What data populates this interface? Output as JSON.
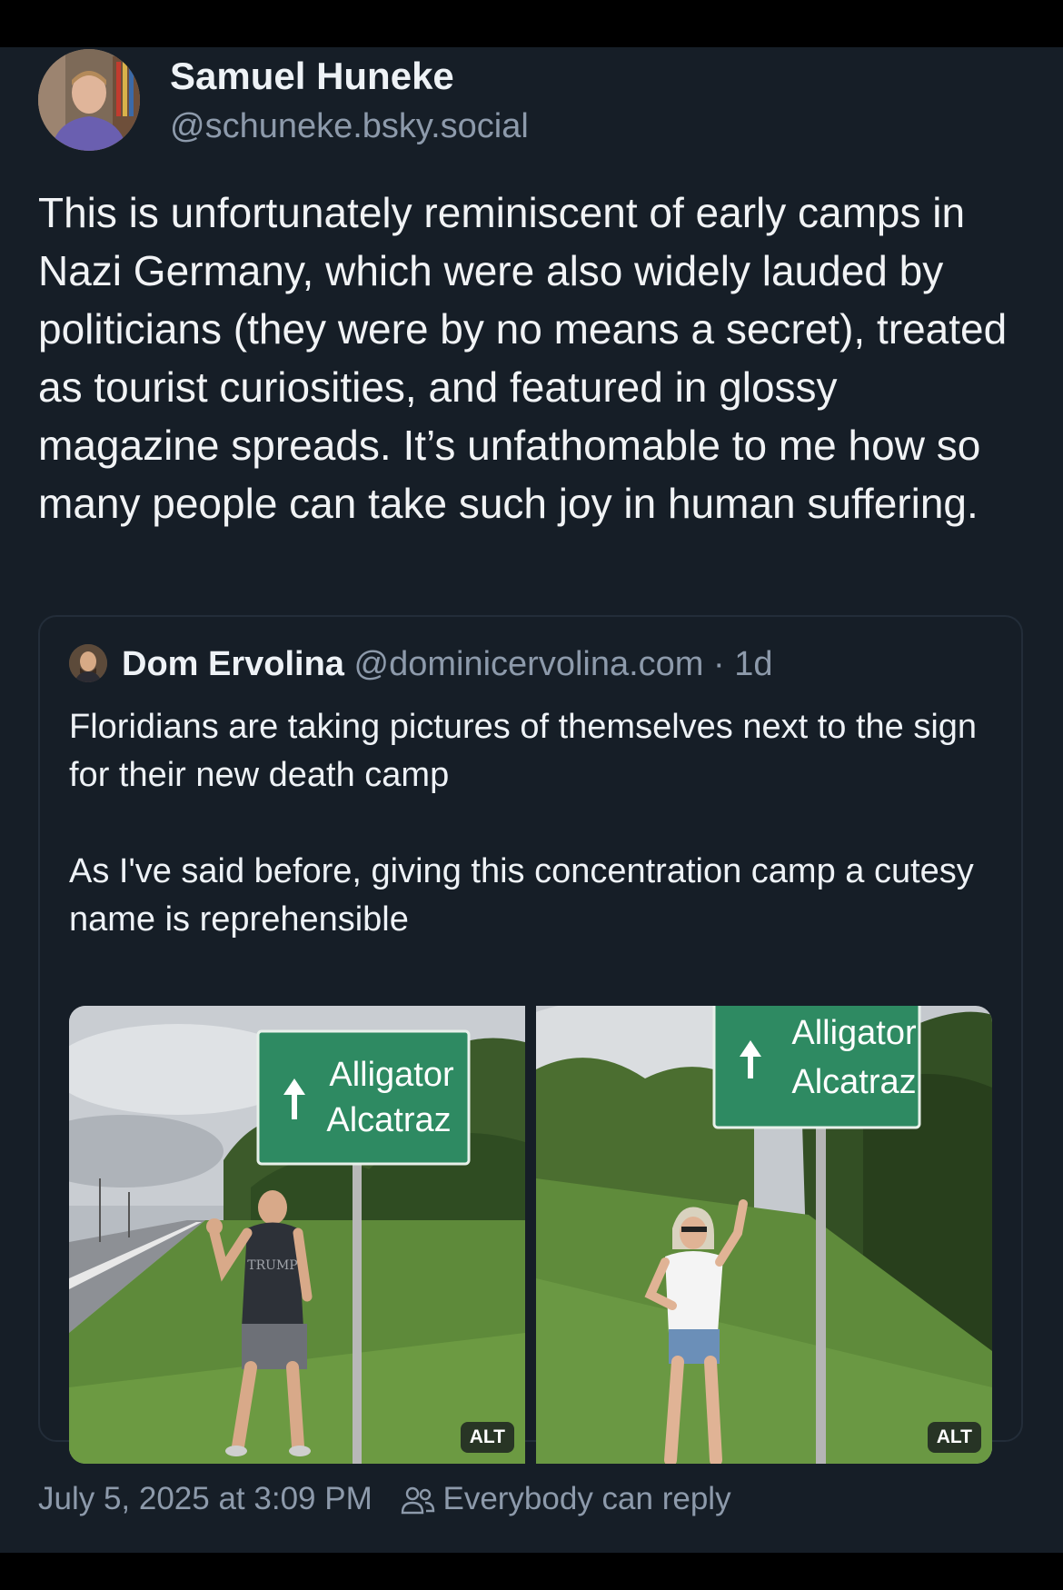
{
  "post": {
    "author": {
      "name": "Samuel Huneke",
      "handle": "@schuneke.bsky.social"
    },
    "text": "This is unfortunately reminiscent of early camps in Nazi Germany, which were also widely lauded by politicians (they were by no means a secret), treated as tourist curiosities, and featured in glossy magazine spreads. It’s unfathomable to me how so many people can take such joy in human suffering.",
    "timestamp": "July 5, 2025 at 3:09 PM",
    "reply_setting": "Everybody can reply"
  },
  "quote": {
    "author": {
      "name": "Dom Ervolina",
      "handle": "@dominicervolina.com"
    },
    "separator": "·",
    "time": "1d",
    "paragraphs": [
      "Floridians are taking pictures of themselves next to the sign for their new death camp",
      "As I've said before, giving this concentration camp a cutesy name is reprehensible"
    ],
    "images": [
      {
        "sign_line1": "Alligator",
        "sign_line2": "Alcatraz",
        "shirt_text": "TRUMP",
        "alt_badge": "ALT"
      },
      {
        "sign_line1": "Alligator",
        "sign_line2": "Alcatraz",
        "alt_badge": "ALT"
      }
    ]
  },
  "colors": {
    "background": "#161e27",
    "text_primary": "#f1f3f5",
    "text_secondary": "#8d9aab",
    "quote_border": "#232d39",
    "sign_green": "#2e8a62"
  },
  "icons": [
    "people-icon",
    "up-arrow-icon"
  ]
}
